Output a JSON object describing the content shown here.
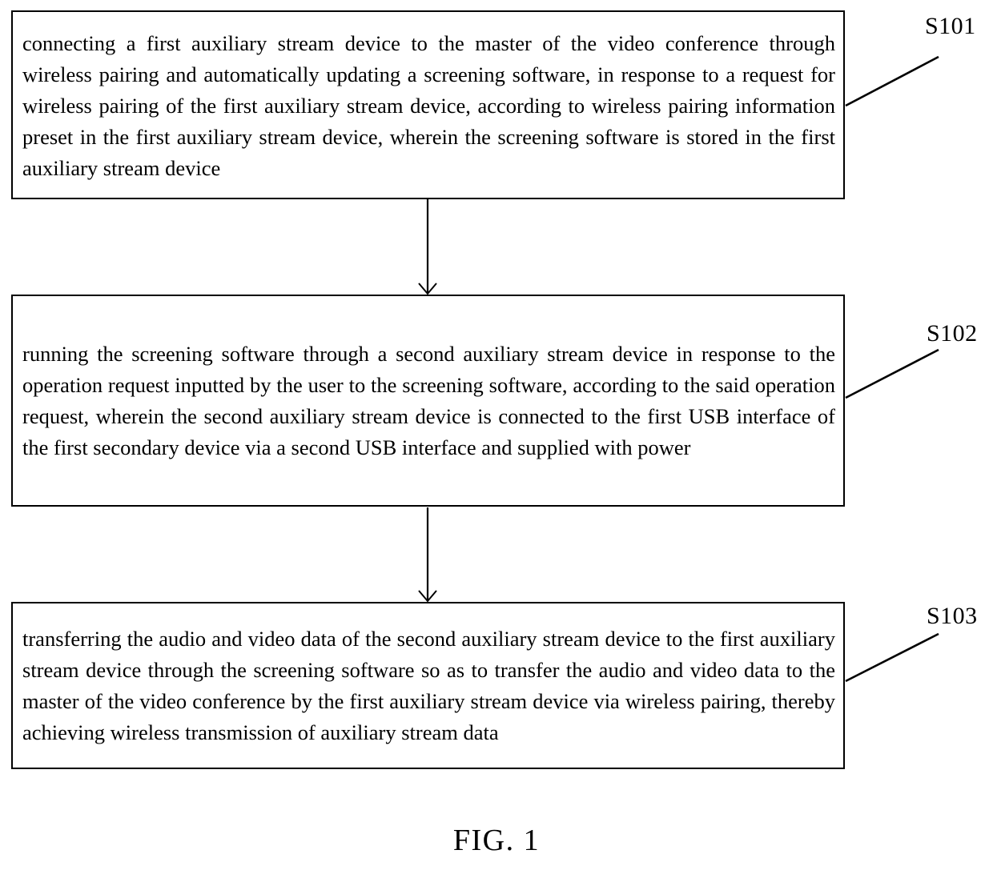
{
  "figure": {
    "caption": "FIG. 1",
    "type": "patent-flowchart",
    "orientation": "vertical",
    "step_count": 3
  },
  "steps": [
    {
      "ref": "S101",
      "text": "connecting a first auxiliary stream device to the master of the video conference through wireless pairing and automatically updating a screening software, in response to a request for wireless pairing of the first auxiliary stream device, according to wireless pairing information preset in the first auxiliary stream device, wherein the screening software is stored in the first auxiliary stream device"
    },
    {
      "ref": "S102",
      "text": "running the screening software through a second auxiliary stream device in response to the operation request inputted by the user to the screening software, according to the said operation request, wherein the second auxiliary stream device is connected to the first USB interface of the first secondary device via a second USB interface and supplied with power"
    },
    {
      "ref": "S103",
      "text": "transferring the audio and video data of the second auxiliary stream device to the first auxiliary stream device through the screening software so as to transfer the audio and video data to the master of the video conference by the first auxiliary stream device via wireless pairing, thereby achieving wireless transmission of auxiliary stream data"
    }
  ],
  "colors": {
    "background": "#ffffff",
    "stroke": "#000000",
    "text": "#000000"
  }
}
